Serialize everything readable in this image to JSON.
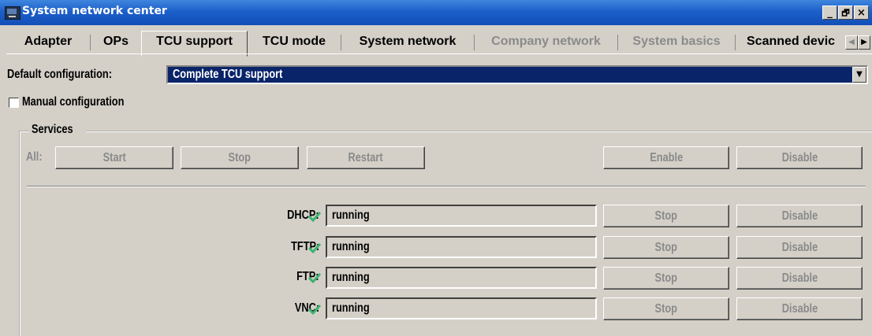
{
  "window": {
    "title": "System network center",
    "controls": {
      "minimize": "_",
      "maximize": "🗗",
      "close": "×"
    }
  },
  "tabs": [
    {
      "label": "Adapter",
      "state": "normal"
    },
    {
      "label": "OPs",
      "state": "normal"
    },
    {
      "label": "TCU support",
      "state": "active"
    },
    {
      "label": "TCU mode",
      "state": "normal"
    },
    {
      "label": "System network",
      "state": "normal"
    },
    {
      "label": "Company network",
      "state": "disabled"
    },
    {
      "label": "System basics",
      "state": "disabled"
    },
    {
      "label": "Scanned devic",
      "state": "normal"
    }
  ],
  "config": {
    "default_label": "Default configuration:",
    "default_value": "Complete TCU support",
    "manual_label": "Manual configuration",
    "manual_checked": false
  },
  "services": {
    "group_label": "Services",
    "all_label": "All:",
    "start_label": "Start",
    "stop_label": "Stop",
    "restart_label": "Restart",
    "enable_label": "Enable",
    "disable_label": "Disable",
    "rows": [
      {
        "name": "DHCP:",
        "status": "running",
        "stop": "Stop",
        "disable": "Disable"
      },
      {
        "name": "TFTP:",
        "status": "running",
        "stop": "Stop",
        "disable": "Disable"
      },
      {
        "name": "FTP:",
        "status": "running",
        "stop": "Stop",
        "disable": "Disable"
      },
      {
        "name": "VNC:",
        "status": "running",
        "stop": "Stop",
        "disable": "Disable"
      }
    ]
  },
  "colors": {
    "title_bar": "#1c5fc9",
    "selection": "#0a246a",
    "check_green": "#3cb371",
    "face": "#d4d0c8"
  }
}
